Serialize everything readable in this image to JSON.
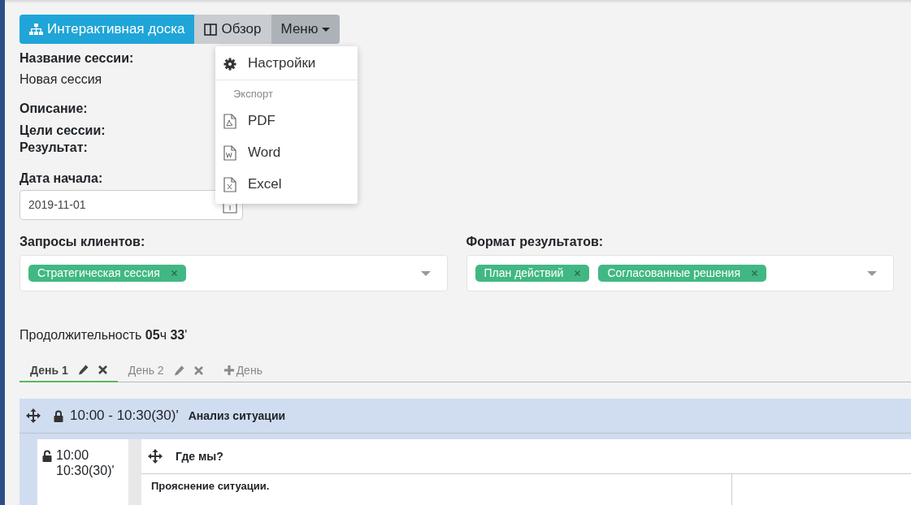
{
  "toolbar": {
    "buttons": [
      {
        "kind": "board",
        "label": "Интерактивная доска"
      },
      {
        "kind": "overview",
        "label": "Обзор"
      },
      {
        "kind": "menu",
        "label": "Меню",
        "expanded": true
      }
    ]
  },
  "menu": {
    "items": [
      {
        "kind": "settings",
        "label": "Настройки"
      },
      {
        "kind": "header",
        "label": "Экспорт"
      },
      {
        "kind": "pdf",
        "label": "PDF"
      },
      {
        "kind": "word",
        "label": "Word"
      },
      {
        "kind": "excel",
        "label": "Excel"
      }
    ]
  },
  "session_name": {
    "label": "Название сессии:",
    "value": "Новая сессия"
  },
  "description": {
    "label": "Описание:"
  },
  "goals": {
    "label": "Цели сессии:"
  },
  "result": {
    "label": "Результат:"
  },
  "start_date": {
    "label": "Дата начала:",
    "value": "2019-11-01"
  },
  "client_requests": {
    "label": "Запросы клиентов:",
    "tags": [
      "Стратегическая сессия"
    ]
  },
  "result_format": {
    "label": "Формат результатов:",
    "tags": [
      "План действий",
      "Согласованные решения"
    ]
  },
  "duration": "Продолжительность **05**ч **33**'",
  "days": {
    "tabs": [
      {
        "label": "День 1",
        "selected": true
      },
      {
        "label": "День 2",
        "selected": false
      }
    ],
    "add_label": "День"
  },
  "block": {
    "locked": true,
    "time": "10:00 - 10:30(30)'",
    "title": "Анализ ситуации",
    "item": {
      "locked": false,
      "time_start": "10:00",
      "time_end": "10:30(30)'",
      "title": "Где мы?",
      "text": "Прояснение ситуации."
    }
  }
}
